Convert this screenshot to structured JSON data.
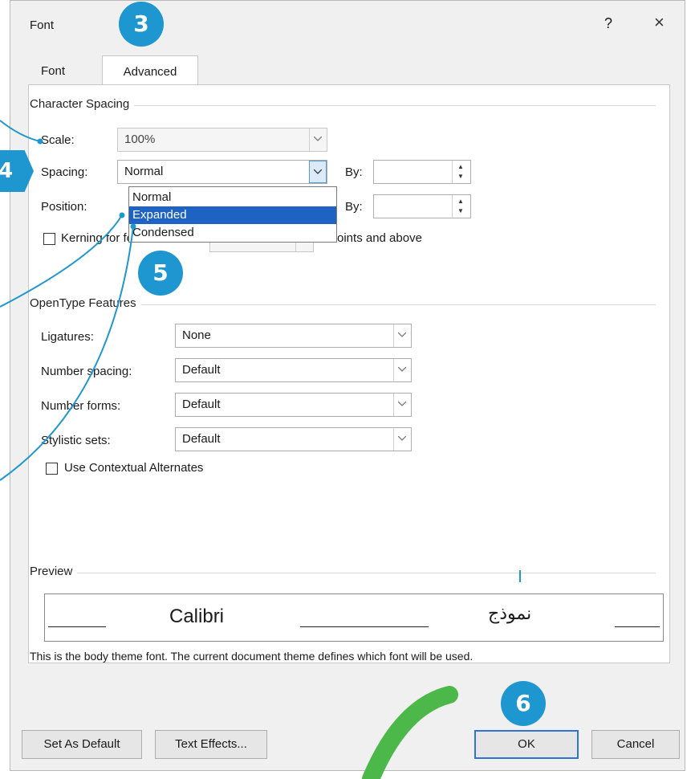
{
  "window": {
    "title": "Font",
    "help": "?",
    "close": "×"
  },
  "tabs": [
    {
      "label": "Font",
      "u": "n"
    },
    {
      "label": "Advanced",
      "u": "v"
    }
  ],
  "character_spacing": {
    "heading": "Character Spacing",
    "scale": {
      "label": "Scale:",
      "value": "100%"
    },
    "spacing": {
      "label": "Spacing:",
      "value": "Normal",
      "by_label": "By:",
      "by_value": ""
    },
    "position": {
      "label": "Position:",
      "by_label": "By:",
      "by_value": ""
    },
    "kerning": {
      "label": "Kerning for fonts:",
      "value": "",
      "suffix": "Points and above"
    },
    "dropdown_options": [
      "Normal",
      "Expanded",
      "Condensed"
    ],
    "selected_option": "Expanded"
  },
  "opentype": {
    "heading": "OpenType Features",
    "ligatures": {
      "label": "Ligatures:",
      "value": "None"
    },
    "number_spacing": {
      "label": "Number spacing:",
      "value": "Default"
    },
    "number_forms": {
      "label": "Number forms:",
      "value": "Default"
    },
    "stylistic_sets": {
      "label": "Stylistic sets:",
      "value": "Default"
    },
    "contextual": {
      "label": "Use Contextual Alternates"
    }
  },
  "preview": {
    "heading": "Preview",
    "sample_latin": "Calibri",
    "sample_arabic": "نموذج",
    "note": "This is the body theme font. The current document theme defines which font will be used."
  },
  "buttons": {
    "set_default": "Set As Default",
    "text_effects": "Text Effects...",
    "ok": "OK",
    "cancel": "Cancel"
  },
  "badges": [
    "3",
    "4",
    "5",
    "6"
  ],
  "colors": {
    "badge": "#1e96cf",
    "selection": "#1e63c4",
    "ok_border": "#2f73d5",
    "swoosh": "#4cb84a"
  }
}
